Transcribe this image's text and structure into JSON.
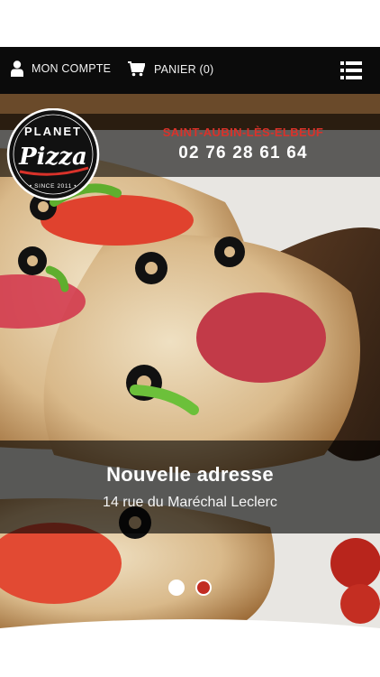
{
  "navbar": {
    "account_label": "MON COMPTE",
    "cart_label": "PANIER (0)"
  },
  "brand": {
    "logo_top": "PLANET",
    "logo_main": "Pizza",
    "logo_since": "• SINCE 2011 •",
    "city": "SAINT-AUBIN-LÈS-ELBEUF",
    "phone": "02 76 28 61 64"
  },
  "slide": {
    "title": "Nouvelle adresse",
    "subtitle": "14 rue du Maréchal Leclerc"
  },
  "carousel": {
    "slide_count": 2,
    "active_index": 1
  },
  "colors": {
    "brand_red": "#d9322a",
    "navbar": "#0b0b0b",
    "dot_active": "#c22c22"
  }
}
